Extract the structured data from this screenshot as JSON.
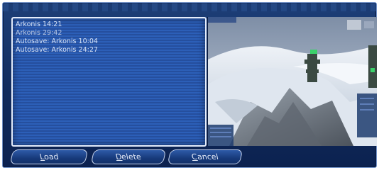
{
  "save_list": {
    "items": [
      {
        "label": "Arkonis 14:21"
      },
      {
        "label": "Arkonis 29:42"
      },
      {
        "label": "Autosave: Arkonis 10:04"
      },
      {
        "label": "Autosave: Arkonis 24:27"
      }
    ]
  },
  "buttons": {
    "load": {
      "first": "L",
      "rest": "oad"
    },
    "delete": {
      "first": "D",
      "rest": "elete"
    },
    "cancel": {
      "first": "C",
      "rest": "ancel"
    }
  },
  "colors": {
    "panel_blue": "#2c5fb8",
    "frame_blue": "#1d3f78",
    "text": "#d9e4f7"
  }
}
